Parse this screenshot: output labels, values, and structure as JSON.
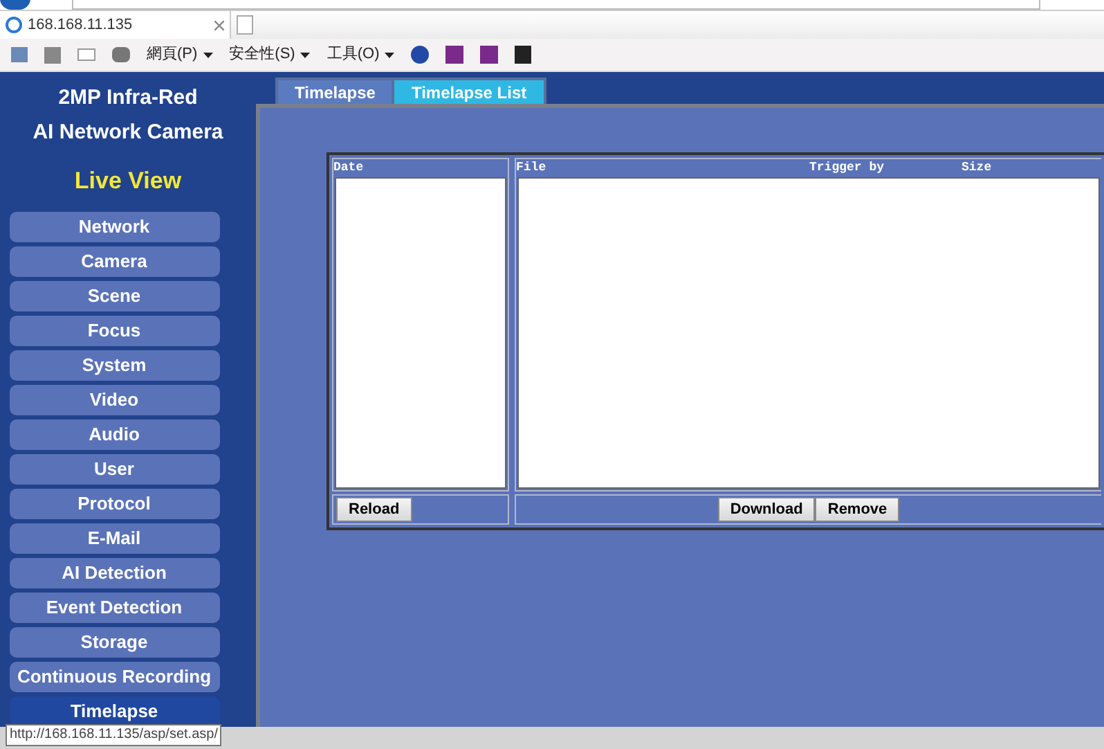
{
  "browser": {
    "tab_title": "168.168.11.135",
    "menus": [
      "網頁(P)",
      "安全性(S)",
      "工具(O)"
    ]
  },
  "sidebar": {
    "title_lines": [
      "2MP Infra-Red",
      "AI Network Camera"
    ],
    "live_view": "Live View",
    "items": [
      {
        "label": "Network",
        "selected": false
      },
      {
        "label": "Camera",
        "selected": false
      },
      {
        "label": "Scene",
        "selected": false
      },
      {
        "label": "Focus",
        "selected": false
      },
      {
        "label": "System",
        "selected": false
      },
      {
        "label": "Video",
        "selected": false
      },
      {
        "label": "Audio",
        "selected": false
      },
      {
        "label": "User",
        "selected": false
      },
      {
        "label": "Protocol",
        "selected": false
      },
      {
        "label": "E-Mail",
        "selected": false
      },
      {
        "label": "AI Detection",
        "selected": false
      },
      {
        "label": "Event Detection",
        "selected": false
      },
      {
        "label": "Storage",
        "selected": false
      },
      {
        "label": "Continuous Recording",
        "selected": false
      },
      {
        "label": "Timelapse",
        "selected": true
      }
    ]
  },
  "tabs": [
    {
      "label": "Timelapse",
      "selected": false
    },
    {
      "label": "Timelapse List",
      "selected": true
    }
  ],
  "date_list": {
    "header": "Date",
    "button": "Reload"
  },
  "file_list": {
    "columns": [
      "File",
      "Trigger by",
      "Size"
    ],
    "buttons": [
      "Download",
      "Remove"
    ]
  },
  "status_tooltip": "http://168.168.11.135/asp/set.asp/"
}
